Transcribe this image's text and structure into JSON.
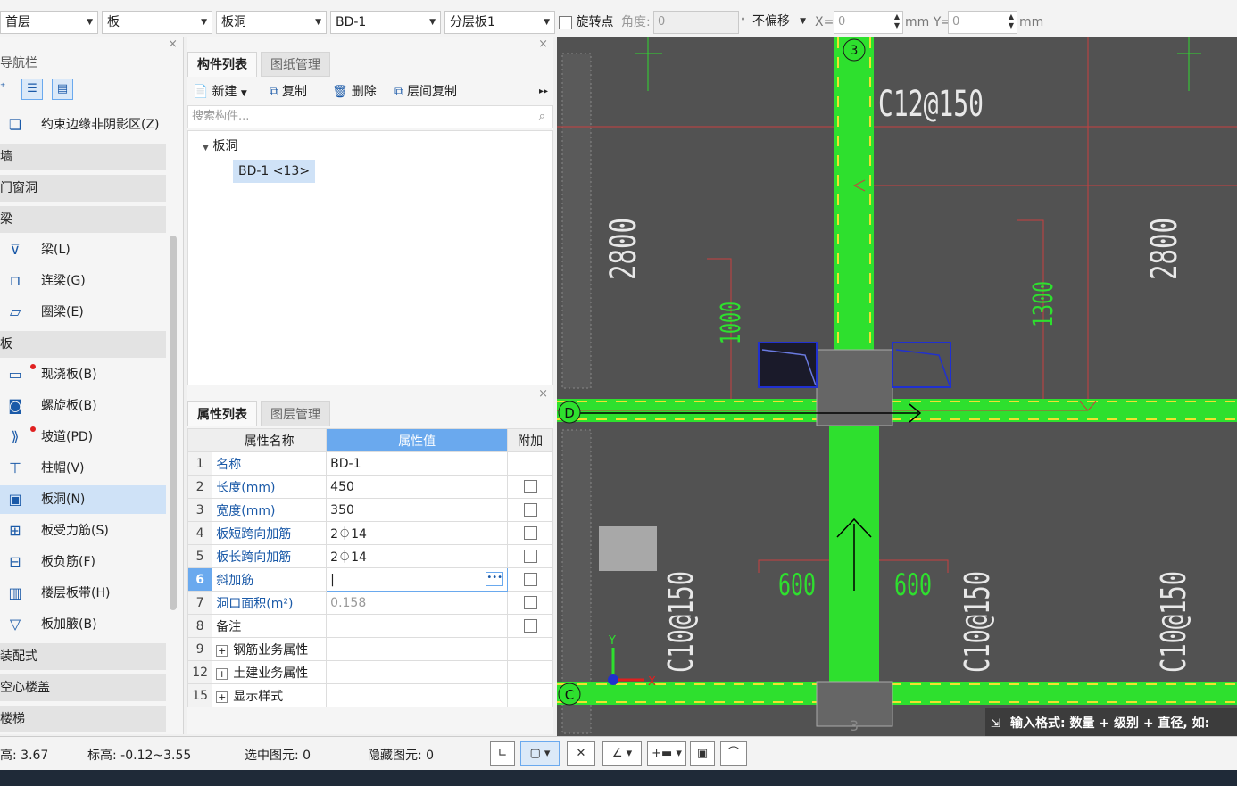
{
  "toolbar": {
    "floor": "首层",
    "category": "板",
    "type": "板洞",
    "component": "BD-1",
    "layer": "分层板1",
    "rotate_label": "旋转点",
    "angle_label": "角度:",
    "angle_value": "0",
    "degree": "°",
    "offset": "不偏移",
    "x_label": "X=",
    "x_value": "0",
    "mm_y": "mm Y=",
    "y_value": "0",
    "mm": "mm"
  },
  "nav": {
    "title": "导航栏",
    "items": [
      {
        "label": "约束边缘非阴影区(Z)",
        "icon": "constraint-edge-icon",
        "kind": "item"
      },
      {
        "label": "墙",
        "kind": "group"
      },
      {
        "label": "门窗洞",
        "kind": "group"
      },
      {
        "label": "梁",
        "kind": "group"
      },
      {
        "label": "梁(L)",
        "icon": "beam-icon",
        "kind": "item"
      },
      {
        "label": "连梁(G)",
        "icon": "coupling-beam-icon",
        "kind": "item"
      },
      {
        "label": "圈梁(E)",
        "icon": "ring-beam-icon",
        "kind": "item"
      },
      {
        "label": "板",
        "kind": "group"
      },
      {
        "label": "现浇板(B)",
        "icon": "cast-slab-icon",
        "kind": "item",
        "dot": true
      },
      {
        "label": "螺旋板(B)",
        "icon": "spiral-slab-icon",
        "kind": "item"
      },
      {
        "label": "坡道(PD)",
        "icon": "ramp-icon",
        "kind": "item",
        "dot": true
      },
      {
        "label": "柱帽(V)",
        "icon": "column-cap-icon",
        "kind": "item"
      },
      {
        "label": "板洞(N)",
        "icon": "slab-hole-icon",
        "kind": "item",
        "selected": true
      },
      {
        "label": "板受力筋(S)",
        "icon": "slab-rebar-icon",
        "kind": "item"
      },
      {
        "label": "板负筋(F)",
        "icon": "slab-negative-rebar-icon",
        "kind": "item"
      },
      {
        "label": "楼层板带(H)",
        "icon": "slab-strip-icon",
        "kind": "item"
      },
      {
        "label": "板加腋(B)",
        "icon": "slab-haunch-icon",
        "kind": "item"
      },
      {
        "label": "装配式",
        "kind": "group"
      },
      {
        "label": "空心楼盖",
        "kind": "group"
      },
      {
        "label": "楼梯",
        "kind": "group"
      }
    ]
  },
  "components": {
    "tabs": [
      "构件列表",
      "图纸管理"
    ],
    "actions": [
      "新建",
      "复制",
      "删除",
      "层间复制"
    ],
    "search_placeholder": "搜索构件...",
    "tree_root": "板洞",
    "tree_item": "BD-1 <13>"
  },
  "properties": {
    "tabs": [
      "属性列表",
      "图层管理"
    ],
    "headers": [
      "属性名称",
      "属性值",
      "附加"
    ],
    "rows": [
      {
        "num": "1",
        "name": "名称",
        "value": "BD-1",
        "check": false
      },
      {
        "num": "2",
        "name": "长度(mm)",
        "value": "450",
        "check": true
      },
      {
        "num": "3",
        "name": "宽度(mm)",
        "value": "350",
        "check": true
      },
      {
        "num": "4",
        "name": "板短跨向加筋",
        "value": "2⏀14",
        "check": true
      },
      {
        "num": "5",
        "name": "板长跨向加筋",
        "value": "2⏀14",
        "check": true
      },
      {
        "num": "6",
        "name": "斜加筋",
        "value": "",
        "check": true,
        "editing": true
      },
      {
        "num": "7",
        "name": "洞口面积(m²)",
        "value": "0.158",
        "check": true,
        "gray": true
      },
      {
        "num": "8",
        "name": "备注",
        "value": "",
        "check": true
      },
      {
        "num": "9",
        "name": "钢筋业务属性",
        "value": "",
        "group": true
      },
      {
        "num": "12",
        "name": "土建业务属性",
        "value": "",
        "group": true
      },
      {
        "num": "15",
        "name": "显示样式",
        "value": "",
        "group": true
      }
    ]
  },
  "canvas": {
    "axis_top": "3",
    "axis_bottom": "3",
    "axis_d": "D",
    "axis_c": "C",
    "rebar_top": "C12@150",
    "dim_2800_left": "2800",
    "dim_2800_right": "2800",
    "dim_1000": "1000",
    "dim_1300": "1300",
    "dim_600_left": "600",
    "dim_600_right": "600",
    "rebar_c10_1": "C10@150",
    "rebar_c10_2": "C10@150",
    "rebar_c10_3": "C10@150",
    "ucs_x": "X",
    "ucs_y": "Y",
    "hint": "输入格式: 数量 + 级别 + 直径, 如:"
  },
  "status": {
    "elevation": "高: 3.67",
    "top_elev": "标高: -0.12~3.55",
    "selected": "选中图元: 0",
    "hidden": "隐藏图元: 0"
  }
}
